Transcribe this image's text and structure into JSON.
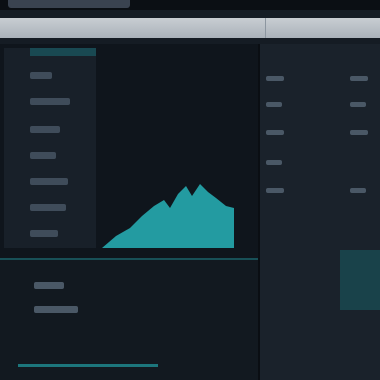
{
  "window": {
    "title": ""
  },
  "sidebar_left": {
    "rows": [
      "",
      "",
      "",
      "",
      "",
      "",
      ""
    ]
  },
  "chart": {
    "type": "area",
    "color": "#27b3b8"
  },
  "bottom_list": {
    "rows": [
      "",
      ""
    ]
  },
  "right_panel": {
    "rows": [
      "",
      "",
      "",
      "",
      "",
      "",
      "",
      "",
      ""
    ]
  },
  "colors": {
    "accent": "#1f8d93",
    "background": "#151c24",
    "header": "#b8bfc6"
  }
}
